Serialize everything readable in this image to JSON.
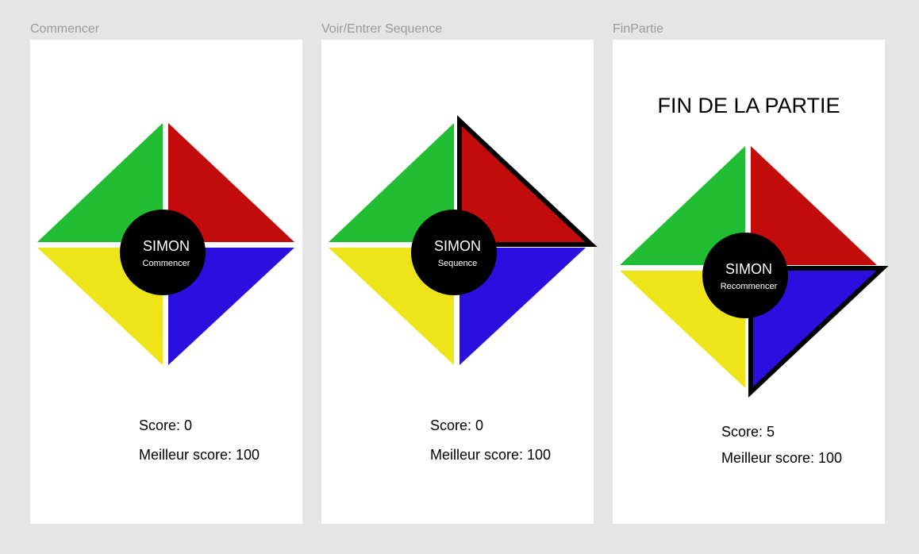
{
  "colors": {
    "green": "#21bd33",
    "red": "#c20c0c",
    "blue": "#2a0fdf",
    "yellow": "#ede51a",
    "center": "#000000",
    "background": "#e5e5e5"
  },
  "frames": [
    {
      "label": "Commencer",
      "title": "SIMON",
      "subtitle": "Commencer",
      "score": "Score: 0",
      "best": "Meilleur score: 100"
    },
    {
      "label": "Voir/Entrer Sequence",
      "title": "SIMON",
      "subtitle": "Sequence",
      "score": "Score: 0",
      "best": "Meilleur score: 100"
    },
    {
      "label": "FinPartie",
      "heading": "FIN DE LA PARTIE",
      "title": "SIMON",
      "subtitle": "Recommencer",
      "score": "Score: 5",
      "best": "Meilleur score: 100"
    }
  ]
}
